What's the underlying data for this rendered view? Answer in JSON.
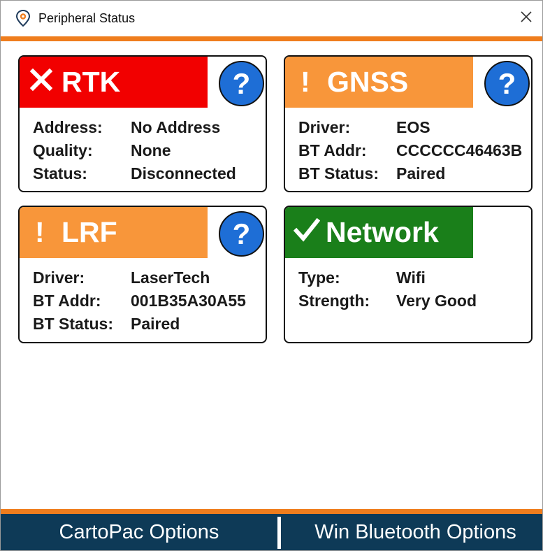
{
  "window": {
    "title": "Peripheral Status",
    "close_glyph": "✕"
  },
  "colors": {
    "accent_orange": "#ef7d1d",
    "error_red": "#f20000",
    "warning_orange": "#f8963a",
    "ok_green": "#1a7f1a",
    "help_blue": "#1e6ed6",
    "bottom_bar": "#0e3a57"
  },
  "cards": {
    "rtk": {
      "status": "error",
      "icon": "x-icon",
      "glyph": "✕",
      "name": "RTK",
      "help": "?",
      "rows": [
        {
          "label": "Address:",
          "value": "No Address"
        },
        {
          "label": "Quality:",
          "value": "None"
        },
        {
          "label": "Status:",
          "value": "Disconnected"
        }
      ]
    },
    "gnss": {
      "status": "warning",
      "icon": "exclamation-icon",
      "glyph": "!",
      "name": "GNSS",
      "help": "?",
      "rows": [
        {
          "label": "Driver:",
          "value": "EOS"
        },
        {
          "label": "BT Addr:",
          "value": "CCCCCC46463B"
        },
        {
          "label": "BT Status:",
          "value": "Paired"
        }
      ]
    },
    "lrf": {
      "status": "warning",
      "icon": "exclamation-icon",
      "glyph": "!",
      "name": "LRF",
      "help": "?",
      "rows": [
        {
          "label": "Driver:",
          "value": "LaserTech"
        },
        {
          "label": "BT Addr:",
          "value": "001B35A30A55"
        },
        {
          "label": "BT Status:",
          "value": "Paired"
        }
      ]
    },
    "network": {
      "status": "ok",
      "icon": "checkmark-icon",
      "glyph": "✓",
      "name": "Network",
      "rows": [
        {
          "label": "Type:",
          "value": "Wifi"
        },
        {
          "label": "Strength:",
          "value": "Very Good"
        }
      ]
    }
  },
  "bottom": {
    "left_label": "CartoPac Options",
    "right_label": "Win Bluetooth Options"
  }
}
